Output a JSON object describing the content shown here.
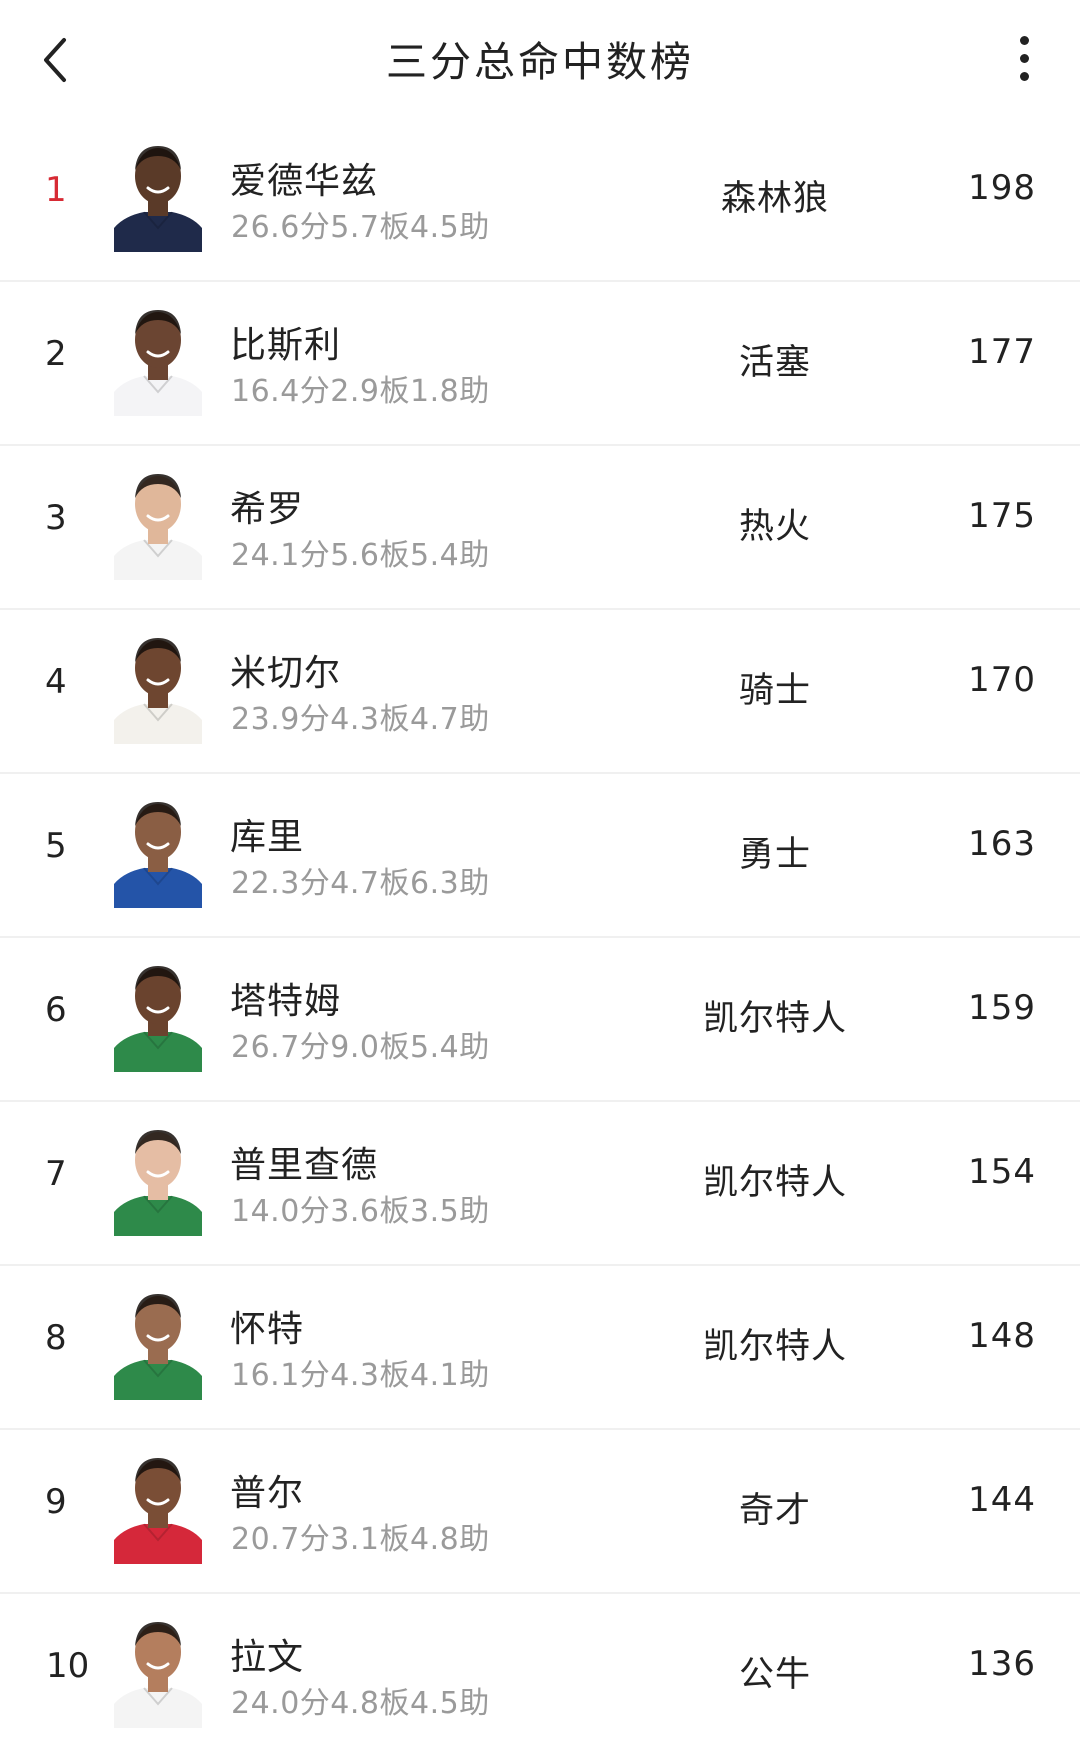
{
  "header": {
    "title": "三分总命中数榜"
  },
  "icons": {
    "back": "chevron-left-icon",
    "more": "more-vertical-icon"
  },
  "colors": {
    "rank_top": "#d72a34",
    "stats_text": "#9a9a9a",
    "divider": "#f0f0f0"
  },
  "players": [
    {
      "rank": "1",
      "name": "爱德华兹",
      "stats": "26.6分5.7板4.5助",
      "team": "森林狼",
      "value": "198",
      "jersey": "#1f2a4a",
      "skin": "#5a3a28"
    },
    {
      "rank": "2",
      "name": "比斯利",
      "stats": "16.4分2.9板1.8助",
      "team": "活塞",
      "value": "177",
      "jersey": "#f4f4f6",
      "skin": "#6b4532"
    },
    {
      "rank": "3",
      "name": "希罗",
      "stats": "24.1分5.6板5.4助",
      "team": "热火",
      "value": "175",
      "jersey": "#f4f4f4",
      "skin": "#e0b79a"
    },
    {
      "rank": "4",
      "name": "米切尔",
      "stats": "23.9分4.3板4.7助",
      "team": "骑士",
      "value": "170",
      "jersey": "#f3f1ec",
      "skin": "#6e4630"
    },
    {
      "rank": "5",
      "name": "库里",
      "stats": "22.3分4.7板6.3助",
      "team": "勇士",
      "value": "163",
      "jersey": "#2454a8",
      "skin": "#8a5e44"
    },
    {
      "rank": "6",
      "name": "塔特姆",
      "stats": "26.7分9.0板5.4助",
      "team": "凯尔特人",
      "value": "159",
      "jersey": "#2e8a4a",
      "skin": "#6a432e"
    },
    {
      "rank": "7",
      "name": "普里查德",
      "stats": "14.0分3.6板3.5助",
      "team": "凯尔特人",
      "value": "154",
      "jersey": "#2e8a4a",
      "skin": "#e5bda4"
    },
    {
      "rank": "8",
      "name": "怀特",
      "stats": "16.1分4.3板4.1助",
      "team": "凯尔特人",
      "value": "148",
      "jersey": "#2e8a4a",
      "skin": "#9a6c50"
    },
    {
      "rank": "9",
      "name": "普尔",
      "stats": "20.7分3.1板4.8助",
      "team": "奇才",
      "value": "144",
      "jersey": "#d5283a",
      "skin": "#7a4e36"
    },
    {
      "rank": "10",
      "name": "拉文",
      "stats": "24.0分4.8板4.5助",
      "team": "公牛",
      "value": "136",
      "jersey": "#f4f4f4",
      "skin": "#b47e5e"
    }
  ]
}
